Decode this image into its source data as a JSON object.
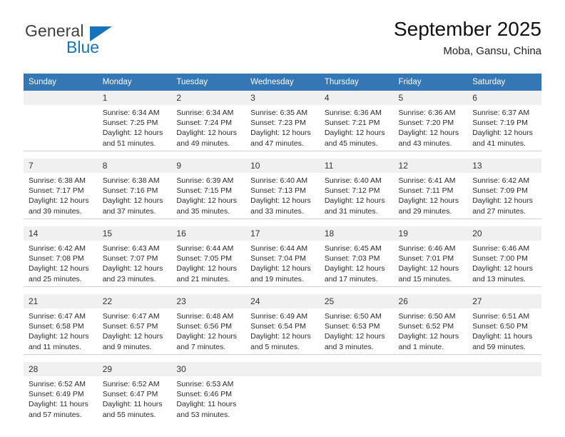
{
  "brand": {
    "name_part1": "General",
    "name_part2": "Blue",
    "accent_color": "#1574bb"
  },
  "header": {
    "title": "September 2025",
    "location": "Moba, Gansu, China",
    "header_bg": "#3576b5",
    "header_text_color": "#ffffff",
    "daynum_bg": "#f0f0f0"
  },
  "weekday_headers": [
    "Sunday",
    "Monday",
    "Tuesday",
    "Wednesday",
    "Thursday",
    "Friday",
    "Saturday"
  ],
  "labels": {
    "sunrise_prefix": "Sunrise:",
    "sunset_prefix": "Sunset:",
    "daylight_prefix": "Daylight:"
  },
  "weeks": [
    [
      {
        "day": "",
        "sunrise": "",
        "sunset": "",
        "daylight_line1": "",
        "daylight_line2": ""
      },
      {
        "day": "1",
        "sunrise": "Sunrise: 6:34 AM",
        "sunset": "Sunset: 7:25 PM",
        "daylight_line1": "Daylight: 12 hours",
        "daylight_line2": "and 51 minutes."
      },
      {
        "day": "2",
        "sunrise": "Sunrise: 6:34 AM",
        "sunset": "Sunset: 7:24 PM",
        "daylight_line1": "Daylight: 12 hours",
        "daylight_line2": "and 49 minutes."
      },
      {
        "day": "3",
        "sunrise": "Sunrise: 6:35 AM",
        "sunset": "Sunset: 7:23 PM",
        "daylight_line1": "Daylight: 12 hours",
        "daylight_line2": "and 47 minutes."
      },
      {
        "day": "4",
        "sunrise": "Sunrise: 6:36 AM",
        "sunset": "Sunset: 7:21 PM",
        "daylight_line1": "Daylight: 12 hours",
        "daylight_line2": "and 45 minutes."
      },
      {
        "day": "5",
        "sunrise": "Sunrise: 6:36 AM",
        "sunset": "Sunset: 7:20 PM",
        "daylight_line1": "Daylight: 12 hours",
        "daylight_line2": "and 43 minutes."
      },
      {
        "day": "6",
        "sunrise": "Sunrise: 6:37 AM",
        "sunset": "Sunset: 7:19 PM",
        "daylight_line1": "Daylight: 12 hours",
        "daylight_line2": "and 41 minutes."
      }
    ],
    [
      {
        "day": "7",
        "sunrise": "Sunrise: 6:38 AM",
        "sunset": "Sunset: 7:17 PM",
        "daylight_line1": "Daylight: 12 hours",
        "daylight_line2": "and 39 minutes."
      },
      {
        "day": "8",
        "sunrise": "Sunrise: 6:38 AM",
        "sunset": "Sunset: 7:16 PM",
        "daylight_line1": "Daylight: 12 hours",
        "daylight_line2": "and 37 minutes."
      },
      {
        "day": "9",
        "sunrise": "Sunrise: 6:39 AM",
        "sunset": "Sunset: 7:15 PM",
        "daylight_line1": "Daylight: 12 hours",
        "daylight_line2": "and 35 minutes."
      },
      {
        "day": "10",
        "sunrise": "Sunrise: 6:40 AM",
        "sunset": "Sunset: 7:13 PM",
        "daylight_line1": "Daylight: 12 hours",
        "daylight_line2": "and 33 minutes."
      },
      {
        "day": "11",
        "sunrise": "Sunrise: 6:40 AM",
        "sunset": "Sunset: 7:12 PM",
        "daylight_line1": "Daylight: 12 hours",
        "daylight_line2": "and 31 minutes."
      },
      {
        "day": "12",
        "sunrise": "Sunrise: 6:41 AM",
        "sunset": "Sunset: 7:11 PM",
        "daylight_line1": "Daylight: 12 hours",
        "daylight_line2": "and 29 minutes."
      },
      {
        "day": "13",
        "sunrise": "Sunrise: 6:42 AM",
        "sunset": "Sunset: 7:09 PM",
        "daylight_line1": "Daylight: 12 hours",
        "daylight_line2": "and 27 minutes."
      }
    ],
    [
      {
        "day": "14",
        "sunrise": "Sunrise: 6:42 AM",
        "sunset": "Sunset: 7:08 PM",
        "daylight_line1": "Daylight: 12 hours",
        "daylight_line2": "and 25 minutes."
      },
      {
        "day": "15",
        "sunrise": "Sunrise: 6:43 AM",
        "sunset": "Sunset: 7:07 PM",
        "daylight_line1": "Daylight: 12 hours",
        "daylight_line2": "and 23 minutes."
      },
      {
        "day": "16",
        "sunrise": "Sunrise: 6:44 AM",
        "sunset": "Sunset: 7:05 PM",
        "daylight_line1": "Daylight: 12 hours",
        "daylight_line2": "and 21 minutes."
      },
      {
        "day": "17",
        "sunrise": "Sunrise: 6:44 AM",
        "sunset": "Sunset: 7:04 PM",
        "daylight_line1": "Daylight: 12 hours",
        "daylight_line2": "and 19 minutes."
      },
      {
        "day": "18",
        "sunrise": "Sunrise: 6:45 AM",
        "sunset": "Sunset: 7:03 PM",
        "daylight_line1": "Daylight: 12 hours",
        "daylight_line2": "and 17 minutes."
      },
      {
        "day": "19",
        "sunrise": "Sunrise: 6:46 AM",
        "sunset": "Sunset: 7:01 PM",
        "daylight_line1": "Daylight: 12 hours",
        "daylight_line2": "and 15 minutes."
      },
      {
        "day": "20",
        "sunrise": "Sunrise: 6:46 AM",
        "sunset": "Sunset: 7:00 PM",
        "daylight_line1": "Daylight: 12 hours",
        "daylight_line2": "and 13 minutes."
      }
    ],
    [
      {
        "day": "21",
        "sunrise": "Sunrise: 6:47 AM",
        "sunset": "Sunset: 6:58 PM",
        "daylight_line1": "Daylight: 12 hours",
        "daylight_line2": "and 11 minutes."
      },
      {
        "day": "22",
        "sunrise": "Sunrise: 6:47 AM",
        "sunset": "Sunset: 6:57 PM",
        "daylight_line1": "Daylight: 12 hours",
        "daylight_line2": "and 9 minutes."
      },
      {
        "day": "23",
        "sunrise": "Sunrise: 6:48 AM",
        "sunset": "Sunset: 6:56 PM",
        "daylight_line1": "Daylight: 12 hours",
        "daylight_line2": "and 7 minutes."
      },
      {
        "day": "24",
        "sunrise": "Sunrise: 6:49 AM",
        "sunset": "Sunset: 6:54 PM",
        "daylight_line1": "Daylight: 12 hours",
        "daylight_line2": "and 5 minutes."
      },
      {
        "day": "25",
        "sunrise": "Sunrise: 6:50 AM",
        "sunset": "Sunset: 6:53 PM",
        "daylight_line1": "Daylight: 12 hours",
        "daylight_line2": "and 3 minutes."
      },
      {
        "day": "26",
        "sunrise": "Sunrise: 6:50 AM",
        "sunset": "Sunset: 6:52 PM",
        "daylight_line1": "Daylight: 12 hours",
        "daylight_line2": "and 1 minute."
      },
      {
        "day": "27",
        "sunrise": "Sunrise: 6:51 AM",
        "sunset": "Sunset: 6:50 PM",
        "daylight_line1": "Daylight: 11 hours",
        "daylight_line2": "and 59 minutes."
      }
    ],
    [
      {
        "day": "28",
        "sunrise": "Sunrise: 6:52 AM",
        "sunset": "Sunset: 6:49 PM",
        "daylight_line1": "Daylight: 11 hours",
        "daylight_line2": "and 57 minutes."
      },
      {
        "day": "29",
        "sunrise": "Sunrise: 6:52 AM",
        "sunset": "Sunset: 6:47 PM",
        "daylight_line1": "Daylight: 11 hours",
        "daylight_line2": "and 55 minutes."
      },
      {
        "day": "30",
        "sunrise": "Sunrise: 6:53 AM",
        "sunset": "Sunset: 6:46 PM",
        "daylight_line1": "Daylight: 11 hours",
        "daylight_line2": "and 53 minutes."
      },
      {
        "day": "",
        "sunrise": "",
        "sunset": "",
        "daylight_line1": "",
        "daylight_line2": ""
      },
      {
        "day": "",
        "sunrise": "",
        "sunset": "",
        "daylight_line1": "",
        "daylight_line2": ""
      },
      {
        "day": "",
        "sunrise": "",
        "sunset": "",
        "daylight_line1": "",
        "daylight_line2": ""
      },
      {
        "day": "",
        "sunrise": "",
        "sunset": "",
        "daylight_line1": "",
        "daylight_line2": ""
      }
    ]
  ]
}
